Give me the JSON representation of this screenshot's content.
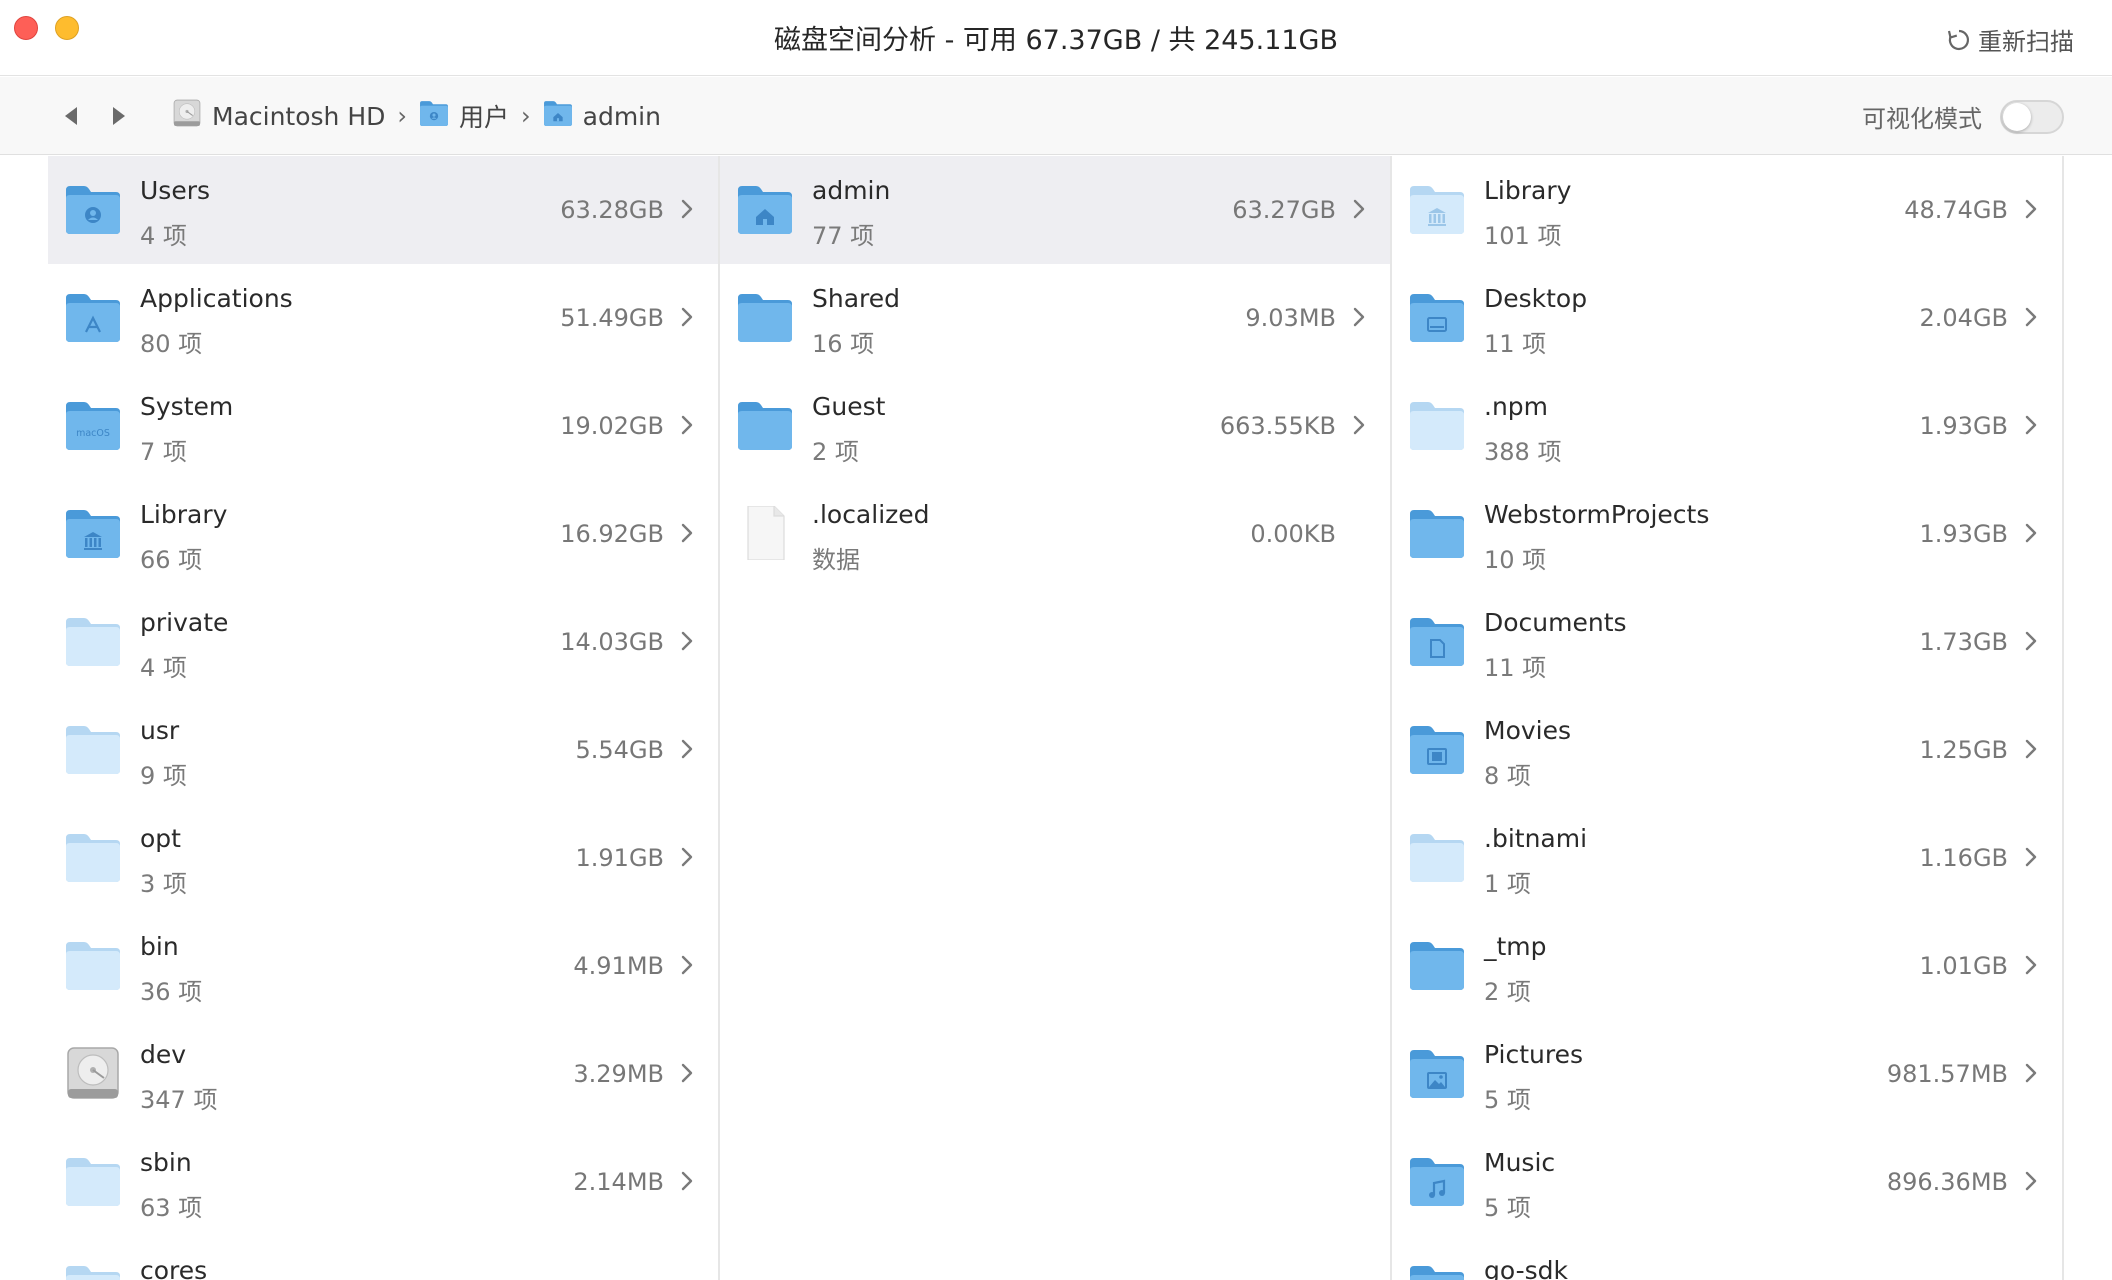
{
  "window": {
    "title": "磁盘空间分析 - 可用 67.37GB / 共 245.11GB",
    "rescan_label": "重新扫描"
  },
  "pathbar": {
    "crumbs": [
      {
        "label": "Macintosh HD",
        "icon": "hard-drive-icon"
      },
      {
        "label": "用户",
        "icon": "users-folder-icon"
      },
      {
        "label": "admin",
        "icon": "home-folder-icon"
      }
    ],
    "separator": "›",
    "visual_mode_label": "可视化模式",
    "visual_mode_on": false
  },
  "columns": [
    {
      "rows": [
        {
          "name": "Users",
          "count": "4 项",
          "size": "63.28GB",
          "icon": "users-folder-icon",
          "selected": true
        },
        {
          "name": "Applications",
          "count": "80 项",
          "size": "51.49GB",
          "icon": "applications-folder-icon"
        },
        {
          "name": "System",
          "count": "7 项",
          "size": "19.02GB",
          "icon": "macos-folder-icon"
        },
        {
          "name": "Library",
          "count": "66 项",
          "size": "16.92GB",
          "icon": "library-folder-icon"
        },
        {
          "name": "private",
          "count": "4 项",
          "size": "14.03GB",
          "icon": "folder-light-icon"
        },
        {
          "name": "usr",
          "count": "9 项",
          "size": "5.54GB",
          "icon": "folder-light-icon"
        },
        {
          "name": "opt",
          "count": "3 项",
          "size": "1.91GB",
          "icon": "folder-light-icon"
        },
        {
          "name": "bin",
          "count": "36 项",
          "size": "4.91MB",
          "icon": "folder-light-icon"
        },
        {
          "name": "dev",
          "count": "347 项",
          "size": "3.29MB",
          "icon": "hard-drive-icon"
        },
        {
          "name": "sbin",
          "count": "63 项",
          "size": "2.14MB",
          "icon": "folder-light-icon"
        },
        {
          "name": "cores",
          "count": "",
          "size": "",
          "icon": "folder-light-icon"
        }
      ]
    },
    {
      "rows": [
        {
          "name": "admin",
          "count": "77 项",
          "size": "63.27GB",
          "icon": "home-folder-icon",
          "selected": true
        },
        {
          "name": "Shared",
          "count": "16 项",
          "size": "9.03MB",
          "icon": "folder-icon"
        },
        {
          "name": "Guest",
          "count": "2 项",
          "size": "663.55KB",
          "icon": "folder-icon"
        },
        {
          "name": ".localized",
          "count": "数据",
          "size": "0.00KB",
          "icon": "document-icon",
          "file": true
        }
      ]
    },
    {
      "rows": [
        {
          "name": "Library",
          "count": "101 项",
          "size": "48.74GB",
          "icon": "library-folder-light-icon"
        },
        {
          "name": "Desktop",
          "count": "11 项",
          "size": "2.04GB",
          "icon": "desktop-folder-icon"
        },
        {
          "name": ".npm",
          "count": "388 项",
          "size": "1.93GB",
          "icon": "folder-light-icon"
        },
        {
          "name": "WebstormProjects",
          "count": "10 项",
          "size": "1.93GB",
          "icon": "folder-icon"
        },
        {
          "name": "Documents",
          "count": "11 项",
          "size": "1.73GB",
          "icon": "documents-folder-icon"
        },
        {
          "name": "Movies",
          "count": "8 项",
          "size": "1.25GB",
          "icon": "movies-folder-icon"
        },
        {
          "name": ".bitnami",
          "count": "1 项",
          "size": "1.16GB",
          "icon": "folder-light-icon"
        },
        {
          "name": "_tmp",
          "count": "2 项",
          "size": "1.01GB",
          "icon": "folder-icon"
        },
        {
          "name": "Pictures",
          "count": "5 项",
          "size": "981.57MB",
          "icon": "pictures-folder-icon"
        },
        {
          "name": "Music",
          "count": "5 项",
          "size": "896.36MB",
          "icon": "music-folder-icon"
        },
        {
          "name": "go-sdk",
          "count": "",
          "size": "",
          "icon": "folder-icon"
        }
      ]
    }
  ],
  "colors": {
    "folder_blue": "#6fb3e9",
    "folder_blue_light": "#c5e1f7",
    "selected_row": "#eeeef2",
    "close": "#fe5f57",
    "minimize": "#febc2e"
  }
}
